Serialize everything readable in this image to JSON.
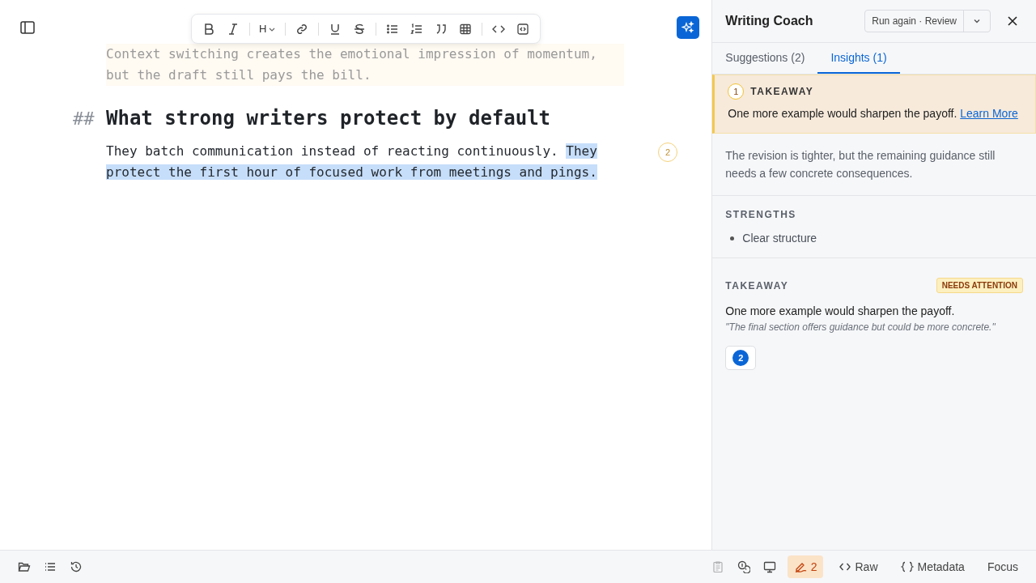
{
  "format_toolbar": {
    "heading_label": "H"
  },
  "editor": {
    "faded_paragraph": "Context switching creates the emotional impression of momentum, but the draft still pays the bill.",
    "heading_marker": "##",
    "heading": "What strong writers protect by default",
    "paragraph_plain": "They batch communication instead of reacting continuously.",
    "paragraph_selected": "They protect the first hour of focused work from meetings and pings.",
    "comment_marker": "2"
  },
  "coach": {
    "title": "Writing Coach",
    "run_again": "Run again · Review",
    "tabs": [
      {
        "label": "Suggestions (2)",
        "selected": false
      },
      {
        "label": "Insights (1)",
        "selected": true
      }
    ],
    "callout": {
      "number": "1",
      "label": "TAKEAWAY",
      "text": "One more example would sharpen the payoff.",
      "link": "Learn More"
    },
    "summary": "The revision is tighter, but the remaining guidance still needs a few concrete consequences.",
    "strengths": {
      "heading": "STRENGTHS",
      "items": [
        "Clear structure"
      ]
    },
    "takeaway": {
      "heading": "TAKEAWAY",
      "badge": "NEEDS ATTENTION",
      "text": "One more example would sharpen the payoff.",
      "quote": "\"The final section offers guidance but could be more concrete.\"",
      "reference": "2"
    }
  },
  "status_bar": {
    "clipboard_disabled": true,
    "review_count": "2",
    "review_active": true,
    "raw": "Raw",
    "metadata": "Metadata",
    "focus": "Focus"
  }
}
